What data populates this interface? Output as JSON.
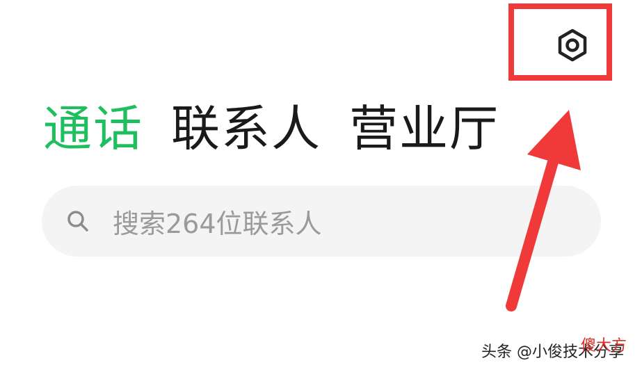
{
  "header": {
    "settings_icon": "gear-hexagon-icon"
  },
  "tabs": [
    {
      "label": "通话",
      "active": true
    },
    {
      "label": "联系人",
      "active": false
    },
    {
      "label": "营业厅",
      "active": false
    }
  ],
  "search": {
    "placeholder": "搜索264位联系人",
    "icon": "search-icon"
  },
  "annotation": {
    "color": "#f03a3a"
  },
  "watermark": {
    "text": "头条 @小俊技术分享",
    "accent_text": "傻大方"
  },
  "colors": {
    "active_tab": "#1fbf5f",
    "inactive_tab": "#1a1a1a",
    "search_bg": "#f4f4f4",
    "placeholder": "#9a9a9a"
  }
}
